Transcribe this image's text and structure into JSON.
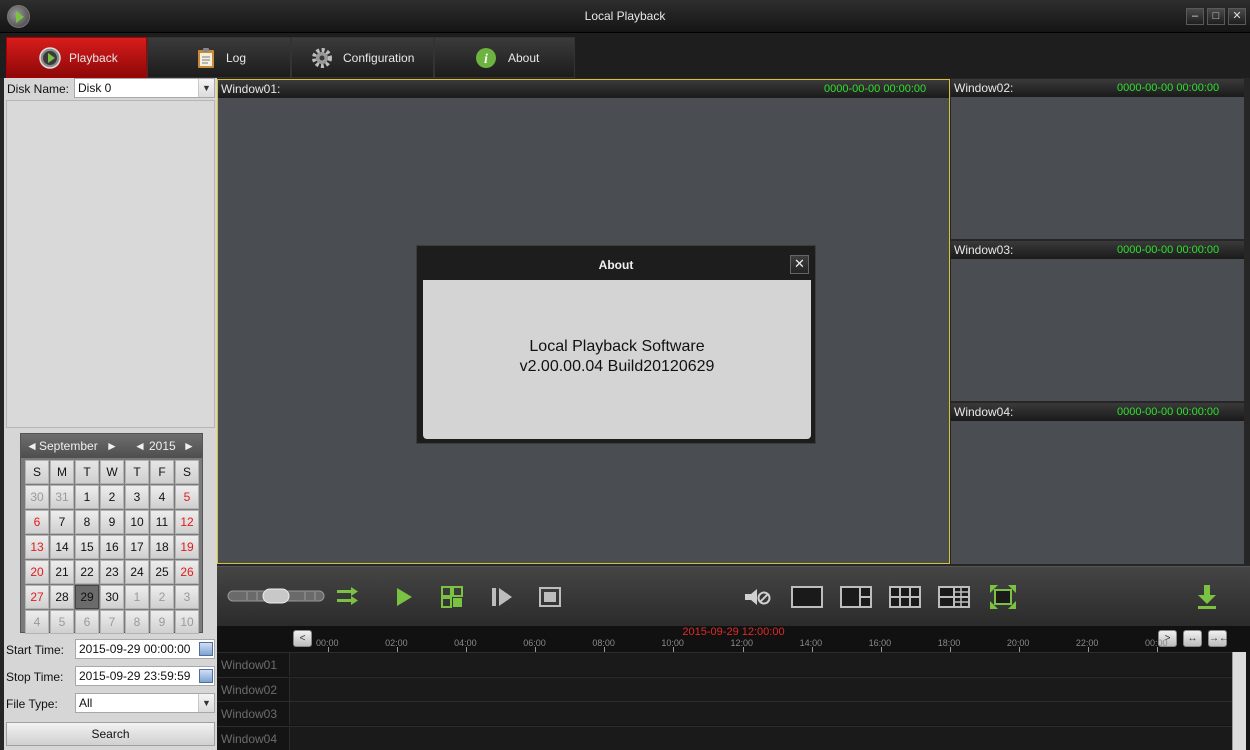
{
  "window": {
    "title": "Local Playback",
    "minimize": "‒",
    "maximize": "□",
    "close": "✕"
  },
  "tabs": [
    {
      "label": "Playback",
      "icon": "playback-icon",
      "active": true
    },
    {
      "label": "Log",
      "icon": "clipboard-icon",
      "active": false
    },
    {
      "label": "Configuration",
      "icon": "gear-icon",
      "active": false
    },
    {
      "label": "About",
      "icon": "info-icon",
      "active": false
    }
  ],
  "sidebar": {
    "disk_label": "Disk Name:",
    "disk_value": "Disk 0",
    "calendar": {
      "month": "September",
      "year": "2015",
      "prev": "◄",
      "next": "►",
      "weekdays": [
        "S",
        "M",
        "T",
        "W",
        "T",
        "F",
        "S"
      ],
      "days": [
        "30",
        "31",
        "1",
        "2",
        "3",
        "4",
        "5",
        "6",
        "7",
        "8",
        "9",
        "10",
        "11",
        "12",
        "13",
        "14",
        "15",
        "16",
        "17",
        "18",
        "19",
        "20",
        "21",
        "22",
        "23",
        "24",
        "25",
        "26",
        "27",
        "28",
        "29",
        "30",
        "1",
        "2",
        "3",
        "4",
        "5",
        "6",
        "7",
        "8",
        "9",
        "10"
      ],
      "selected_day": "29"
    },
    "start_label": "Start Time:",
    "start_value": "2015-09-29 00:00:00",
    "stop_label": "Stop Time:",
    "stop_value": "2015-09-29 23:59:59",
    "filetype_label": "File Type:",
    "filetype_value": "All",
    "search_label": "Search"
  },
  "video_windows": [
    {
      "name": "Window01:",
      "time": "0000-00-00 00:00:00"
    },
    {
      "name": "Window02:",
      "time": "0000-00-00 00:00:00"
    },
    {
      "name": "Window03:",
      "time": "0000-00-00 00:00:00"
    },
    {
      "name": "Window04:",
      "time": "0000-00-00 00:00:00"
    }
  ],
  "about_dialog": {
    "title": "About",
    "close": "✕",
    "line1": "Local Playback Software",
    "line2": "v2.00.00.04 Build20120629"
  },
  "timeline": {
    "current_time": "2015-09-29 12:00:00",
    "ticks": [
      "00:00",
      "02:00",
      "04:00",
      "06:00",
      "08:00",
      "10:00",
      "12:00",
      "14:00",
      "16:00",
      "18:00",
      "20:00",
      "22:00",
      "00:00"
    ],
    "prev": "<",
    "next": ">",
    "zoom_in": "↔",
    "zoom_out": "→←",
    "rows": [
      "Window01",
      "Window02",
      "Window03",
      "Window04"
    ]
  },
  "colors": {
    "accent_red": "#d81c1c",
    "icon_green": "#7bc142",
    "time_green": "#2ee02e",
    "weekend_red": "#e21b1b",
    "selected_window_border": "#d8c233"
  }
}
